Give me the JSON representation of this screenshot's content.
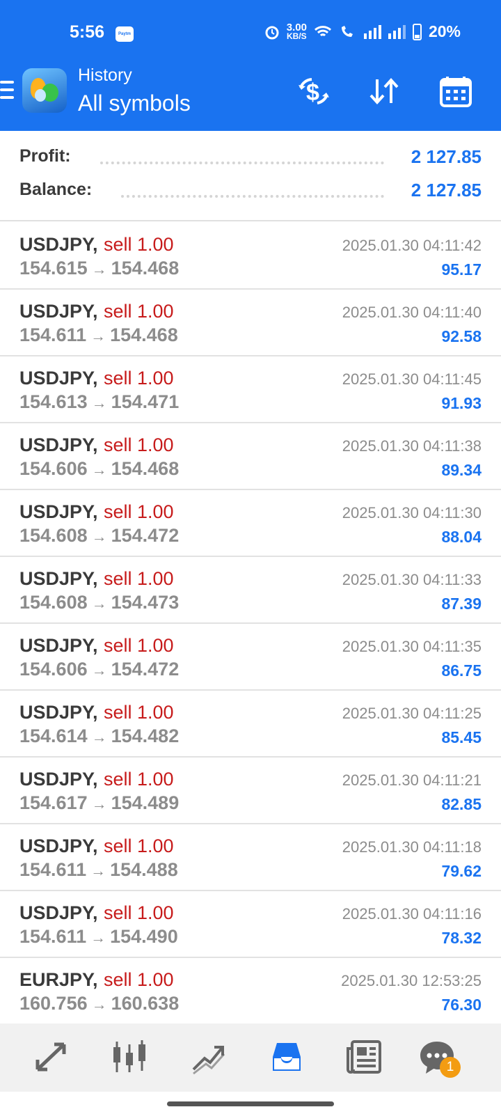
{
  "status": {
    "time": "5:56",
    "paytm": "Paytm",
    "speed_value": "3.00",
    "speed_unit": "KB/S",
    "battery": "20%"
  },
  "app_bar": {
    "line1": "History",
    "line2": "All symbols",
    "icons": [
      "currency-exchange-icon",
      "sort-icon",
      "calendar-icon"
    ]
  },
  "summary": {
    "profit_label": "Profit:",
    "profit_value": "2 127.85",
    "balance_label": "Balance:",
    "balance_value": "2 127.85"
  },
  "trades": [
    {
      "symbol": "USDJPY,",
      "side": "sell 1.00",
      "open": "154.615",
      "close": "154.468",
      "time": "2025.01.30 04:11:42",
      "profit": "95.17"
    },
    {
      "symbol": "USDJPY,",
      "side": "sell 1.00",
      "open": "154.611",
      "close": "154.468",
      "time": "2025.01.30 04:11:40",
      "profit": "92.58"
    },
    {
      "symbol": "USDJPY,",
      "side": "sell 1.00",
      "open": "154.613",
      "close": "154.471",
      "time": "2025.01.30 04:11:45",
      "profit": "91.93"
    },
    {
      "symbol": "USDJPY,",
      "side": "sell 1.00",
      "open": "154.606",
      "close": "154.468",
      "time": "2025.01.30 04:11:38",
      "profit": "89.34"
    },
    {
      "symbol": "USDJPY,",
      "side": "sell 1.00",
      "open": "154.608",
      "close": "154.472",
      "time": "2025.01.30 04:11:30",
      "profit": "88.04"
    },
    {
      "symbol": "USDJPY,",
      "side": "sell 1.00",
      "open": "154.608",
      "close": "154.473",
      "time": "2025.01.30 04:11:33",
      "profit": "87.39"
    },
    {
      "symbol": "USDJPY,",
      "side": "sell 1.00",
      "open": "154.606",
      "close": "154.472",
      "time": "2025.01.30 04:11:35",
      "profit": "86.75"
    },
    {
      "symbol": "USDJPY,",
      "side": "sell 1.00",
      "open": "154.614",
      "close": "154.482",
      "time": "2025.01.30 04:11:25",
      "profit": "85.45"
    },
    {
      "symbol": "USDJPY,",
      "side": "sell 1.00",
      "open": "154.617",
      "close": "154.489",
      "time": "2025.01.30 04:11:21",
      "profit": "82.85"
    },
    {
      "symbol": "USDJPY,",
      "side": "sell 1.00",
      "open": "154.611",
      "close": "154.488",
      "time": "2025.01.30 04:11:18",
      "profit": "79.62"
    },
    {
      "symbol": "USDJPY,",
      "side": "sell 1.00",
      "open": "154.611",
      "close": "154.490",
      "time": "2025.01.30 04:11:16",
      "profit": "78.32"
    },
    {
      "symbol": "EURJPY,",
      "side": "sell 1.00",
      "open": "160.756",
      "close": "160.638",
      "time": "2025.01.30 12:53:25",
      "profit": "76.30"
    }
  ],
  "arrow_glyph": "→",
  "bottom_nav": {
    "items": [
      "quotes-icon",
      "chart-icon",
      "trade-icon",
      "history-icon",
      "news-icon",
      "chat-icon"
    ],
    "active": "history-icon",
    "chat_badge": "1"
  },
  "colors": {
    "primary": "#1a73f0",
    "sell": "#c71b1b",
    "muted": "#8c8c8c",
    "text": "#3a3a3a"
  }
}
